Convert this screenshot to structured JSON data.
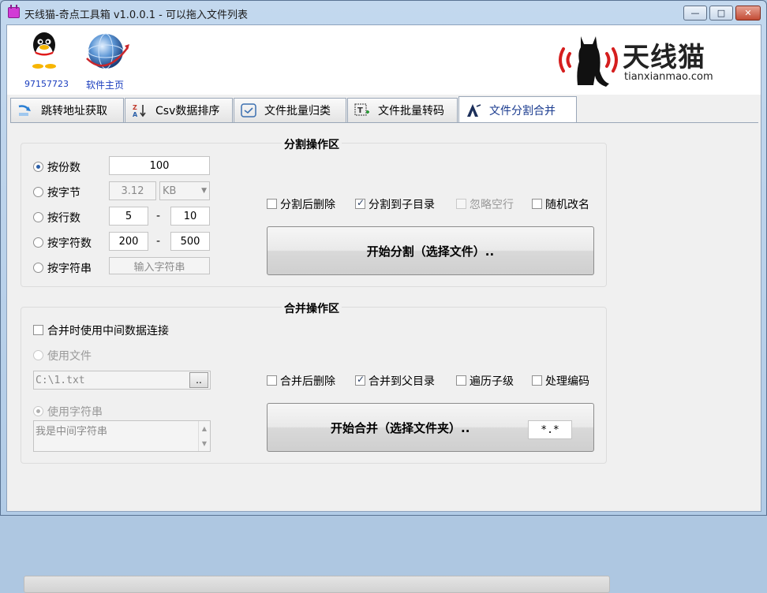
{
  "window": {
    "title": "天线猫-奇点工具箱 v1.0.0.1 - 可以拖入文件列表",
    "buttons": {
      "minimize": "—",
      "maximize": "□",
      "close": "✕"
    }
  },
  "header": {
    "qq_number": "97157723",
    "homepage_label": "软件主页",
    "logo_text": "天线猫",
    "logo_url": "tianxianmao.com"
  },
  "tabs": [
    {
      "label": "跳转地址获取",
      "icon": "redirect-arrow-icon"
    },
    {
      "label": "Csv数据排序",
      "icon": "sort-az-icon"
    },
    {
      "label": "文件批量归类",
      "icon": "classify-icon"
    },
    {
      "label": "文件批量转码",
      "icon": "transcode-icon"
    },
    {
      "label": "文件分割合并",
      "icon": "split-merge-icon",
      "active": true
    }
  ],
  "split": {
    "title": "分割操作区",
    "by_count": {
      "label": "按份数",
      "value": "100",
      "selected": true
    },
    "by_bytes": {
      "label": "按字节",
      "value": "3.12",
      "unit": "KB"
    },
    "by_lines": {
      "label": "按行数",
      "from": "5",
      "to": "10"
    },
    "by_chars": {
      "label": "按字符数",
      "from": "200",
      "to": "500"
    },
    "by_string": {
      "label": "按字符串",
      "placeholder": "输入字符串"
    },
    "range_sep": "-",
    "options": [
      {
        "label": "分割后删除",
        "checked": false,
        "enabled": true
      },
      {
        "label": "分割到子目录",
        "checked": true,
        "enabled": true
      },
      {
        "label": "忽略空行",
        "checked": false,
        "enabled": false
      },
      {
        "label": "随机改名",
        "checked": false,
        "enabled": true
      }
    ],
    "start_button": "开始分割（选择文件）.."
  },
  "merge": {
    "title": "合并操作区",
    "use_middle": {
      "label": "合并时使用中间数据连接",
      "checked": false
    },
    "use_file": {
      "label": "使用文件",
      "path": "C:\\1.txt",
      "browse": ".."
    },
    "use_string": {
      "label": "使用字符串",
      "value": "我是中间字符串",
      "selected": true
    },
    "options": [
      {
        "label": "合并后删除",
        "checked": false
      },
      {
        "label": "合并到父目录",
        "checked": true
      },
      {
        "label": "遍历子级",
        "checked": false
      },
      {
        "label": "处理编码",
        "checked": false
      }
    ],
    "start_button": "开始合并（选择文件夹）..",
    "filter": "*.*"
  },
  "progress": {
    "value": 0
  }
}
